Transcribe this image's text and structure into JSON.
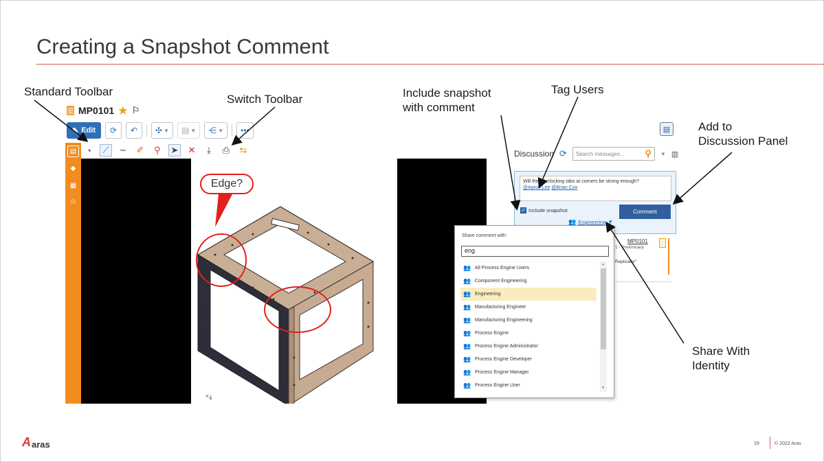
{
  "slide": {
    "title": "Creating a Snapshot Comment",
    "page_number": "19",
    "copyright": "© 2022 Aras",
    "logo_text": "aras"
  },
  "callouts": {
    "standard_toolbar": "Standard Toolbar",
    "switch_toolbar": "Switch Toolbar",
    "include_snapshot_line1": "Include snapshot",
    "include_snapshot_line2": "with comment",
    "tag_users": "Tag Users",
    "add_to_line1": "Add to",
    "add_to_line2": "Discussion Panel",
    "share_with_line1": "Share With",
    "share_with_line2": "Identity",
    "bubble_text": "Edge?"
  },
  "item": {
    "name": "MP0101"
  },
  "toolbar": {
    "edit_label": "Edit",
    "more_label": "•••"
  },
  "discussion": {
    "label": "Discussion",
    "search_placeholder": "Search messages...",
    "comment_text_prefix": "Will the interlocking tabs at corners be strong enough?",
    "mention_1": "@Aaron Lee",
    "mention_2": "@Brian Cox",
    "include_snapshot_label": "Include snapshot",
    "comment_button": "Comment",
    "share_identity": "Engineering",
    "feed": {
      "link": "MP0101",
      "sub": "1 - Preliminary",
      "quote": "Replicator\""
    }
  },
  "share_popup": {
    "heading": "Share comment with:",
    "search_value": "eng",
    "items": [
      "All Process Engine Users",
      "Component Engineering",
      "Engineering",
      "Manufacturing Engineer",
      "Manufacturing Engineering",
      "Process Engine",
      "Process Engine Administrator",
      "Process Engine Developer",
      "Process Engine Manager",
      "Process Engine User"
    ],
    "selected": "Engineering"
  },
  "colors": {
    "accent_orange": "#f28c1e",
    "primary_blue": "#2f6fb8",
    "markup_red": "#e0201c",
    "selected_row": "#fbecbf"
  },
  "icons": [
    "document-icon",
    "star-icon",
    "flag-icon",
    "pencil-icon",
    "refresh-icon",
    "rotate-icon",
    "explode-icon",
    "clipboard-icon",
    "share-icon",
    "chat-icon",
    "search-icon"
  ]
}
